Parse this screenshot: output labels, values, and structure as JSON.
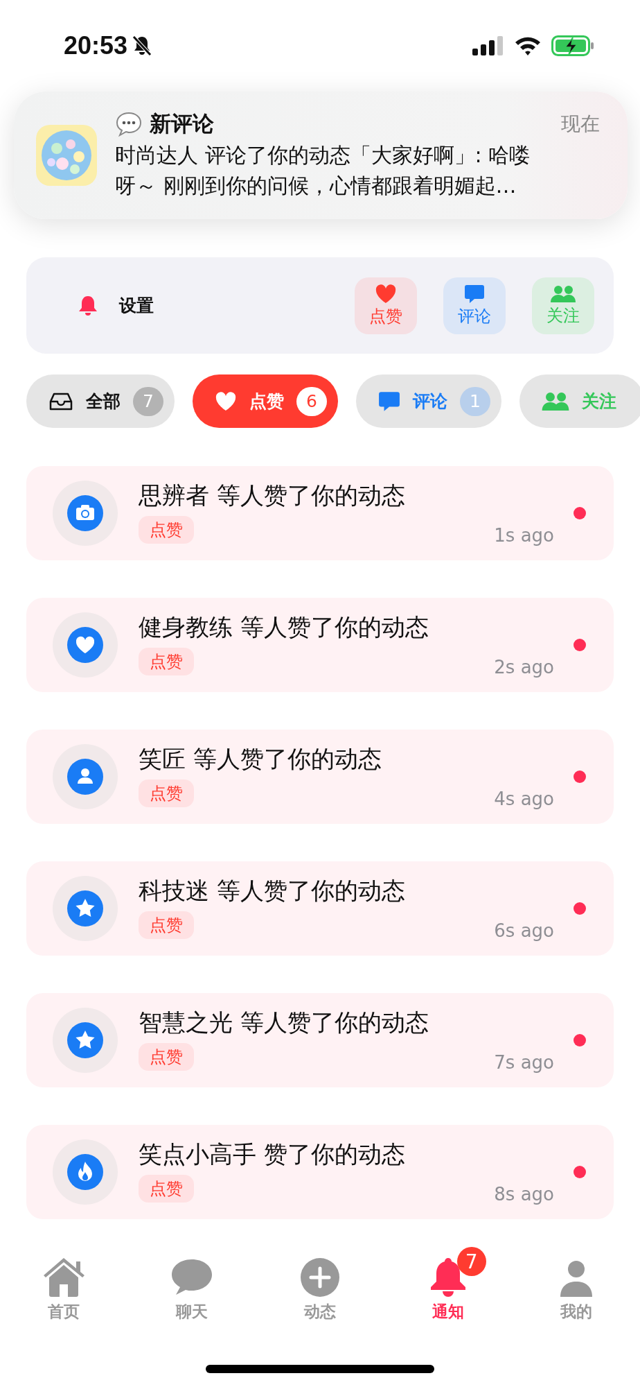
{
  "status_bar": {
    "time": "20:53"
  },
  "banner": {
    "title": "新评论",
    "time": "现在",
    "body": "时尚达人 评论了你的动态「大家好啊」: 哈喽呀～ 刚刚到你的问候，心情都跟着明媚起…"
  },
  "settings": {
    "label": "设置",
    "shortcuts": [
      {
        "kind": "like",
        "label": "点赞"
      },
      {
        "kind": "comment",
        "label": "评论"
      },
      {
        "kind": "follow",
        "label": "关注"
      }
    ]
  },
  "filters": [
    {
      "kind": "all",
      "label": "全部",
      "count": "7",
      "selected": false
    },
    {
      "kind": "like",
      "label": "点赞",
      "count": "6",
      "selected": true
    },
    {
      "kind": "comment",
      "label": "评论",
      "count": "1",
      "selected": false
    },
    {
      "kind": "follow",
      "label": "关注",
      "selected": false
    }
  ],
  "notifications": [
    {
      "kind": "camera",
      "title": "思辨者 等人赞了你的动态",
      "tag": "点赞",
      "time": "1s ago",
      "unread": true
    },
    {
      "kind": "heart",
      "title": "健身教练 等人赞了你的动态",
      "tag": "点赞",
      "time": "2s ago",
      "unread": true
    },
    {
      "kind": "person",
      "title": "笑匠 等人赞了你的动态",
      "tag": "点赞",
      "time": "4s ago",
      "unread": true
    },
    {
      "kind": "star",
      "title": "科技迷 等人赞了你的动态",
      "tag": "点赞",
      "time": "6s ago",
      "unread": true
    },
    {
      "kind": "star",
      "title": "智慧之光 等人赞了你的动态",
      "tag": "点赞",
      "time": "7s ago",
      "unread": true
    },
    {
      "kind": "flame",
      "title": "笑点小高手 赞了你的动态",
      "tag": "点赞",
      "time": "8s ago",
      "unread": true
    }
  ],
  "tab_bar": [
    {
      "kind": "home",
      "label": "首页",
      "selected": false
    },
    {
      "kind": "chat",
      "label": "聊天",
      "selected": false
    },
    {
      "kind": "post",
      "label": "动态",
      "selected": false
    },
    {
      "kind": "bell",
      "label": "通知",
      "selected": true,
      "badge": "7"
    },
    {
      "kind": "profile",
      "label": "我的",
      "selected": false
    }
  ]
}
